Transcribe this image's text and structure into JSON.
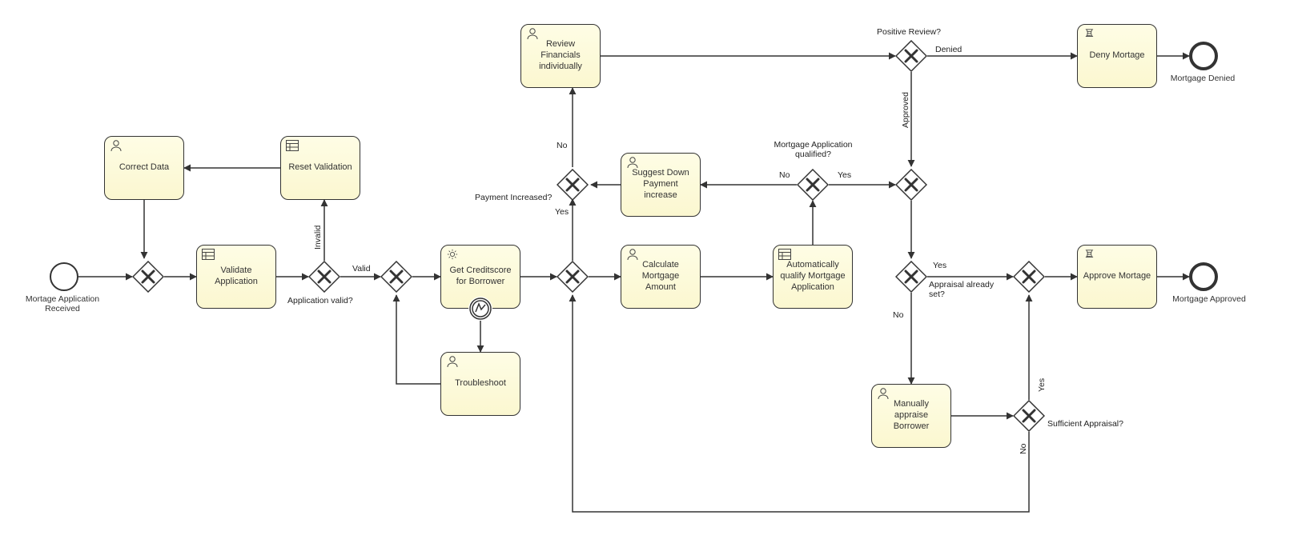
{
  "chart_data": {
    "type": "bpmn-process",
    "nodes": [
      {
        "id": "start",
        "kind": "startEvent",
        "label": "Mortage Application Received"
      },
      {
        "id": "gw1",
        "kind": "exclusiveGateway"
      },
      {
        "id": "validate",
        "kind": "businessRuleTask",
        "label": "Validate Application"
      },
      {
        "id": "gw2",
        "kind": "exclusiveGateway",
        "label": "Application valid?"
      },
      {
        "id": "correctData",
        "kind": "userTask",
        "label": "Correct Data"
      },
      {
        "id": "resetVal",
        "kind": "businessRuleTask",
        "label": "Reset Validation"
      },
      {
        "id": "gw3",
        "kind": "exclusiveGateway"
      },
      {
        "id": "getCredit",
        "kind": "serviceTask",
        "label": "Get Creditscore for Borrower"
      },
      {
        "id": "trouble",
        "kind": "userTask",
        "label": "Troubleshoot"
      },
      {
        "id": "gw4",
        "kind": "exclusiveGateway",
        "label": "Payment Increased?"
      },
      {
        "id": "reviewFin",
        "kind": "userTask",
        "label": "Review Financials individually"
      },
      {
        "id": "calcMort",
        "kind": "userTask",
        "label": "Calculate Mortgage Amount"
      },
      {
        "id": "autoQual",
        "kind": "businessRuleTask",
        "label": "Automatically qualify Mortgage Application"
      },
      {
        "id": "gw5",
        "kind": "exclusiveGateway",
        "label": "Mortgage Application qualified?"
      },
      {
        "id": "suggestDP",
        "kind": "userTask",
        "label": "Suggest Down Payment increase"
      },
      {
        "id": "gw6",
        "kind": "exclusiveGateway",
        "label": "Positive Review?"
      },
      {
        "id": "gw7",
        "kind": "exclusiveGateway"
      },
      {
        "id": "gw8",
        "kind": "exclusiveGateway",
        "label": "Appraisal already set?"
      },
      {
        "id": "denyMort",
        "kind": "scriptTask",
        "label": "Deny Mortage"
      },
      {
        "id": "endDenied",
        "kind": "endEvent",
        "label": "Mortgage Denied"
      },
      {
        "id": "appraise",
        "kind": "userTask",
        "label": "Manually appraise Borrower"
      },
      {
        "id": "gw9",
        "kind": "exclusiveGateway",
        "label": "Sufficient Appraisal?"
      },
      {
        "id": "gw10",
        "kind": "exclusiveGateway"
      },
      {
        "id": "approveMort",
        "kind": "scriptTask",
        "label": "Approve Mortage"
      },
      {
        "id": "endApproved",
        "kind": "endEvent",
        "label": "Mortgage Approved"
      },
      {
        "id": "errBoundary",
        "kind": "boundaryErrorEvent",
        "attachedTo": "getCredit"
      }
    ],
    "edges": [
      {
        "from": "start",
        "to": "gw1"
      },
      {
        "from": "gw1",
        "to": "validate"
      },
      {
        "from": "validate",
        "to": "gw2"
      },
      {
        "from": "gw2",
        "to": "resetVal",
        "label": "Invalid"
      },
      {
        "from": "resetVal",
        "to": "correctData"
      },
      {
        "from": "correctData",
        "to": "gw1"
      },
      {
        "from": "gw2",
        "to": "gw3",
        "label": "Valid"
      },
      {
        "from": "gw3",
        "to": "getCredit"
      },
      {
        "from": "errBoundary",
        "to": "trouble"
      },
      {
        "from": "trouble",
        "to": "gw3"
      },
      {
        "from": "getCredit",
        "to": "gw4"
      },
      {
        "from": "gw4",
        "to": "reviewFin",
        "label": "No"
      },
      {
        "from": "gw4",
        "to": "calcMort",
        "label": "Yes"
      },
      {
        "from": "calcMort",
        "to": "autoQual"
      },
      {
        "from": "autoQual",
        "to": "gw5"
      },
      {
        "from": "gw5",
        "to": "suggestDP",
        "label": "No"
      },
      {
        "from": "gw5",
        "to": "gw7",
        "label": "Yes"
      },
      {
        "from": "suggestDP",
        "to": "gw4"
      },
      {
        "from": "reviewFin",
        "to": "gw6"
      },
      {
        "from": "gw6",
        "to": "denyMort",
        "label": "Denied"
      },
      {
        "from": "gw6",
        "to": "gw7",
        "label": "Approved"
      },
      {
        "from": "gw7",
        "to": "gw8"
      },
      {
        "from": "gw8",
        "to": "gw10",
        "label": "Yes"
      },
      {
        "from": "gw8",
        "to": "appraise",
        "label": "No"
      },
      {
        "from": "appraise",
        "to": "gw9"
      },
      {
        "from": "gw9",
        "to": "gw10",
        "label": "Yes"
      },
      {
        "from": "gw9",
        "to": "gw4",
        "label": "No"
      },
      {
        "from": "gw10",
        "to": "approveMort"
      },
      {
        "from": "approveMort",
        "to": "endApproved"
      },
      {
        "from": "denyMort",
        "to": "endDenied"
      }
    ]
  },
  "events": {
    "start": {
      "label": "Mortage Application Received"
    },
    "endDenied": {
      "label": "Mortgage Denied"
    },
    "endApproved": {
      "label": "Mortgage Approved"
    }
  },
  "tasks": {
    "correctData": "Correct Data",
    "resetVal": "Reset Validation",
    "validate": "Validate Application",
    "getCredit": "Get Creditscore for Borrower",
    "trouble": "Troubleshoot",
    "reviewFin": "Review Financials individually",
    "suggestDP": "Suggest Down Payment increase",
    "calcMort": "Calculate Mortgage Amount",
    "autoQual": "Automatically qualify Mortgage Application",
    "appraise": "Manually appraise Borrower",
    "denyMort": "Deny Mortage",
    "approveMort": "Approve Mortage"
  },
  "gatewayLabels": {
    "gw2": "Application valid?",
    "gw4": "Payment Increased?",
    "gw5": "Mortgage Application qualified?",
    "gw6": "Positive Review?",
    "gw8": "Appraisal already set?",
    "gw9": "Sufficient Appraisal?"
  },
  "edgeLabels": {
    "invalid": "Invalid",
    "valid": "Valid",
    "noPI": "No",
    "yesPI": "Yes",
    "noQual": "No",
    "yesQual": "Yes",
    "denied": "Denied",
    "approved": "Approved",
    "yesAppr": "Yes",
    "noAppr": "No",
    "yesSuf": "Yes",
    "noSuf": "No"
  }
}
